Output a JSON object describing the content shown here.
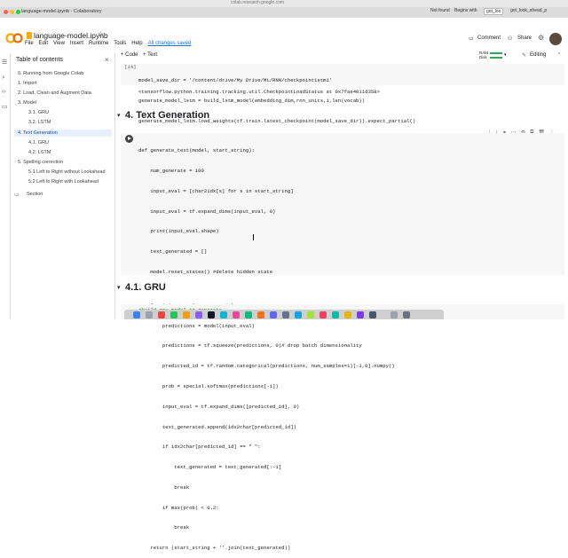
{
  "browser": {
    "url": "colab.research.google.com",
    "tab_title": "language-model.ipynb - Colaboratory",
    "right_items": [
      "Not found",
      "Begins with",
      "got_loo",
      "got_look_ahead_p"
    ]
  },
  "colab": {
    "file_name": "language-model.ipynb",
    "menu": [
      "File",
      "Edit",
      "View",
      "Insert",
      "Runtime",
      "Tools",
      "Help"
    ],
    "saved_status": "All changes saved",
    "comment_label": "Comment",
    "share_label": "Share"
  },
  "toolbar": {
    "add_code": "+ Code",
    "add_text": "+ Text",
    "ram_label": "RAM",
    "disk_label": "Disk",
    "editing_label": "Editing"
  },
  "toc": {
    "title": "Table of contents",
    "items": [
      {
        "label": "0. Running from Google Colab",
        "level": 0
      },
      {
        "label": "1. Import",
        "level": 0
      },
      {
        "label": "2. Load, Clean and Augment Data",
        "level": 0
      },
      {
        "label": "3. Model",
        "level": 0
      },
      {
        "label": "3.1. GRU",
        "level": 1
      },
      {
        "label": "3.2. LSTM",
        "level": 1
      },
      {
        "label": "4. Text Generation",
        "level": 0,
        "active": true
      },
      {
        "label": "4.1. GRU",
        "level": 1
      },
      {
        "label": "4.2. LSTM",
        "level": 1
      },
      {
        "label": "5. Spelling correction",
        "level": 0
      },
      {
        "label": "5.1 Left to Right without Lookahead",
        "level": 1
      },
      {
        "label": "5.2 Left to Right with Lookahead",
        "level": 1
      },
      {
        "label": "Section",
        "level": 0
      }
    ]
  },
  "cell14": {
    "prompt": "[14]",
    "lines": [
      "model_save_dir = '/content/drive/My Drive/ML/RNN/checkpoint1stm1'",
      "generate_model_lstm = build_lstm_model(embedding_dim,rnn_units,1,len(vocab))",
      "generate_model_lstm.load_weights(tf.train.latest_checkpoint(model_save_dir)).expect_partial()"
    ],
    "output": "<tensorflow.python.training.tracking.util.CheckpointLoadStatus at 0x7fae4011d358>"
  },
  "heading_text_generation": "4. Text Generation",
  "cell_generate": {
    "lines": [
      "def generate_text(model, start_string):",
      "    num_generate = 100",
      "    input_eval = [char2idx[s] for s in start_string]",
      "    input_eval = tf.expand_dims(input_eval, 0)",
      "    print(input_eval.shape)",
      "    text_generated = []",
      "    model.reset_states() #delete hidden state",
      "",
      "    for i in range(num_generate):",
      "        predictions = model(input_eval)",
      "        predictions = tf.squeeze(predictions, 0)# drop batch dimensionality",
      "        predicted_id = tf.random.categorical(predictions, num_samples=1)[-1,0].numpy()",
      "        prob = special.softmax(predictions[-1])",
      "        input_eval = tf.expand_dims([predicted_id], 0)",
      "        text_generated.append(idx2char[predicted_id])",
      "        if idx2char[predicted_id] == \" \":",
      "            text_generated = text_generated[:-1]",
      "            break",
      "        if max(prob) < 0.2:",
      "            break",
      "    return (start_string + ''.join(text_generated))"
    ]
  },
  "heading_gru": "4.1. GRU",
  "cell_next_partial": "#build gru model to generate"
}
